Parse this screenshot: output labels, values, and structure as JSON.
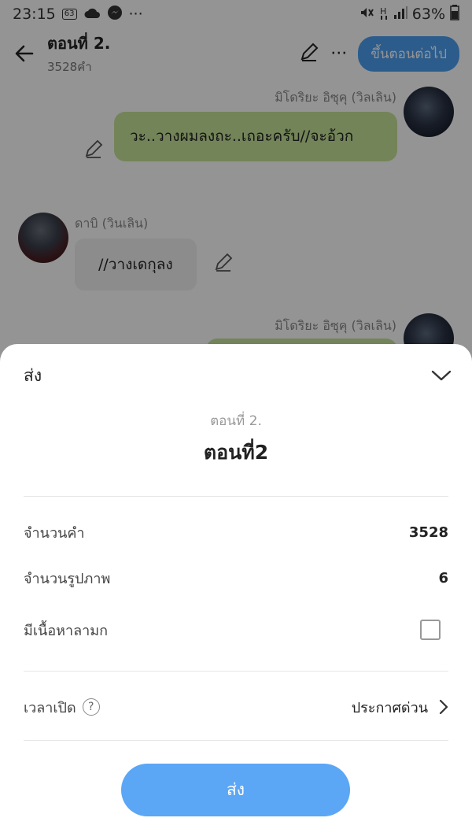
{
  "status": {
    "time": "23:15",
    "badge": "63",
    "battery": "63%",
    "more": "···"
  },
  "header": {
    "title": "ตอนที่ 2.",
    "subtitle": "3528คำ",
    "next_button": "ขึ้นตอนต่อไป",
    "more": "···"
  },
  "chat": {
    "messages": [
      {
        "sender": "มิโดริยะ อิซุคุ (วิลเลิน)",
        "text": "วะ..วางผมลงถะ..เถอะครับ//จะอ้วก"
      },
      {
        "sender": "ดาบิ (วินเลิน)",
        "text": "//วางเดกุลง"
      },
      {
        "sender": "มิโดริยะ อิซุคุ (วิลเลิน)"
      }
    ]
  },
  "sheet": {
    "title": "ส่ง",
    "episode_sub": "ตอนที่ 2.",
    "episode_title": "ตอนที่2",
    "rows": {
      "word_count_label": "จำนวนคำ",
      "word_count_value": "3528",
      "image_count_label": "จำนวนรูปภาพ",
      "image_count_value": "6",
      "explicit_label": "มีเนื้อหาลามก",
      "explicit_checked": false
    },
    "open_time_label": "เวลาเปิด",
    "open_time_help": "?",
    "open_time_value": "ประกาศด่วน",
    "send_button": "ส่ง"
  },
  "colors": {
    "accent": "#5ba6f5",
    "green_bubble": "#c7e39a",
    "grey_bubble": "#f1f1f1"
  }
}
